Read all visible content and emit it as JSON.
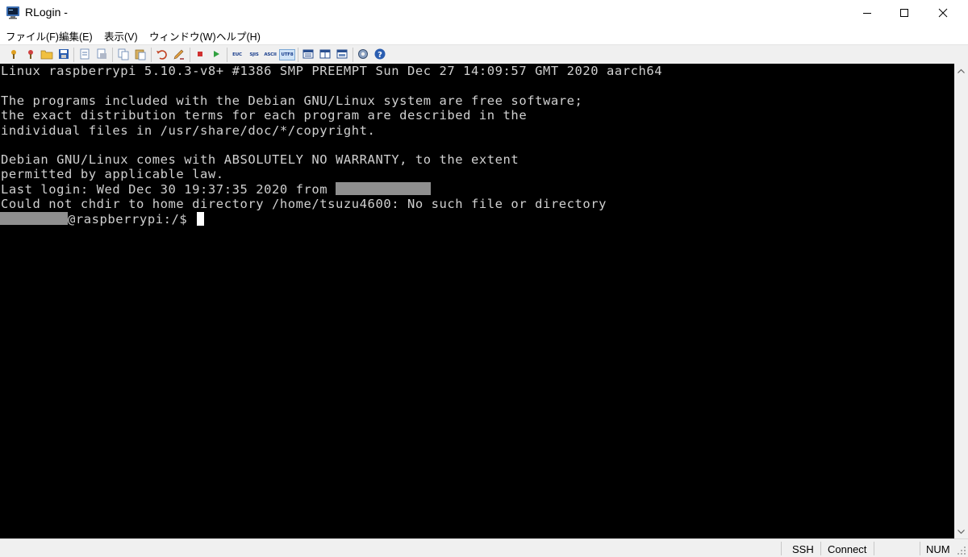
{
  "window": {
    "title": "RLogin -"
  },
  "menu": [
    "ファイル(F)",
    "編集(E)",
    "表示(V)",
    "ウィンドウ(W)",
    "ヘルプ(H)"
  ],
  "toolbar": {
    "icons": [
      "new-connection-icon",
      "connect-icon",
      "open-folder-icon",
      "save-icon",
      "document-icon",
      "print-icon",
      "copy-icon",
      "paste-icon",
      "undo-icon",
      "edit-icon",
      "stop-icon",
      "play-icon"
    ],
    "encodings": [
      "EUC",
      "SJIS",
      "ASCII",
      "UTF8"
    ],
    "active_encoding": "UTF8",
    "view_icons": [
      "view-1-icon",
      "view-2-icon",
      "view-3-icon",
      "settings-icon",
      "help-icon"
    ]
  },
  "terminal": {
    "line1": "Linux raspberrypi 5.10.3-v8+ #1386 SMP PREEMPT Sun Dec 27 14:09:57 GMT 2020 aarch64",
    "line2": "The programs included with the Debian GNU/Linux system are free software;",
    "line3": "the exact distribution terms for each program are described in the",
    "line4": "individual files in /usr/share/doc/*/copyright.",
    "line5": "Debian GNU/Linux comes with ABSOLUTELY NO WARRANTY, to the extent",
    "line6": "permitted by applicable law.",
    "line7": "Last login: Wed Dec 30 19:37:35 2020 from ",
    "line8": "Could not chdir to home directory /home/tsuzu4600: No such file or directory",
    "prompt": "@raspberrypi:/$ "
  },
  "status": {
    "protocol": "SSH",
    "state": "Connect",
    "numlock": "NUM"
  },
  "colors": {
    "terminal_bg": "#000000",
    "terminal_fg": "#d0d0d0",
    "redaction": "#8f8f8f"
  }
}
